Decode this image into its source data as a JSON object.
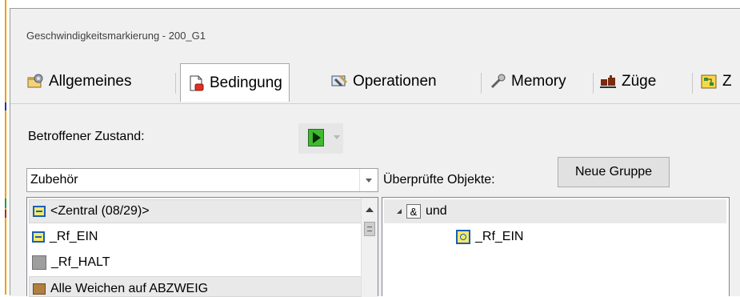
{
  "window": {
    "title": "Geschwindigkeitsmarkierung - 200_G1"
  },
  "tabs": [
    {
      "label": "Allgemeines",
      "icon": "settings-icon"
    },
    {
      "label": "Bedingung",
      "icon": "condition-icon",
      "active": true
    },
    {
      "label": "Operationen",
      "icon": "operations-icon"
    },
    {
      "label": "Memory",
      "icon": "memory-icon"
    },
    {
      "label": "Züge",
      "icon": "trains-icon"
    },
    {
      "label": "Z",
      "icon": "more-icon"
    }
  ],
  "state": {
    "label": "Betroffener Zustand:"
  },
  "category": {
    "value": "Zubehör"
  },
  "checked": {
    "label": "Überprüfte Objekte:",
    "new_group": "Neue Gruppe"
  },
  "list": {
    "items": [
      {
        "label": "<Zentral (08/29)>",
        "selected": true
      },
      {
        "label": "_Rf_EIN"
      },
      {
        "label": "_Rf_HALT"
      },
      {
        "label": "Alle Weichen auf ABZWEIG"
      }
    ]
  },
  "tree": {
    "root": {
      "op": "&",
      "label": "und"
    },
    "children": [
      {
        "label": "_Rf_EIN"
      }
    ]
  },
  "colors": {
    "accent": "#3dbb2e",
    "icon_blue": "#1a5fb4",
    "icon_yellow": "#f6e86a"
  }
}
